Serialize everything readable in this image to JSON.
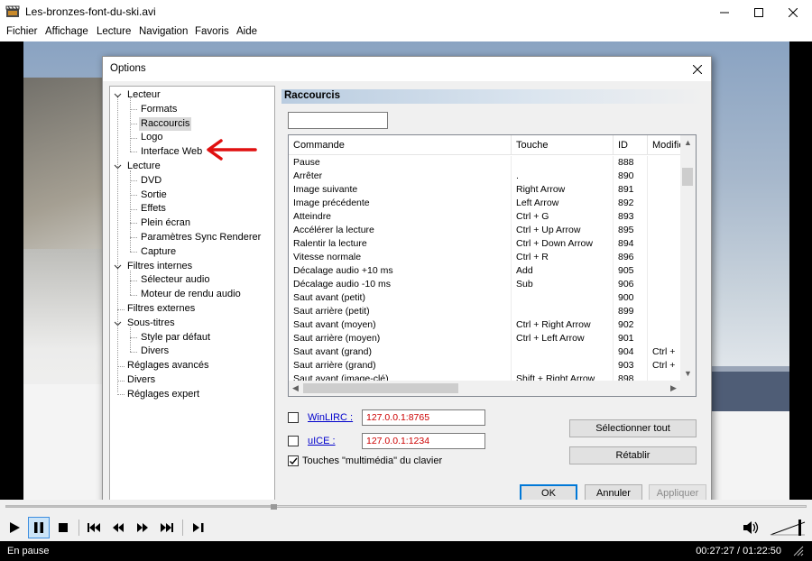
{
  "window": {
    "title": "Les-bronzes-font-du-ski.avi"
  },
  "menu": {
    "items": [
      "Fichier",
      "Affichage",
      "Lecture",
      "Navigation",
      "Favoris",
      "Aide"
    ]
  },
  "dialog": {
    "title": "Options",
    "tree": [
      {
        "label": "Lecteur"
      },
      {
        "label": "Formats"
      },
      {
        "label": "Raccourcis"
      },
      {
        "label": "Logo"
      },
      {
        "label": "Interface Web"
      },
      {
        "label": "Lecture"
      },
      {
        "label": "DVD"
      },
      {
        "label": "Sortie"
      },
      {
        "label": "Effets"
      },
      {
        "label": "Plein écran"
      },
      {
        "label": "Paramètres Sync Renderer"
      },
      {
        "label": "Capture"
      },
      {
        "label": "Filtres internes"
      },
      {
        "label": "Sélecteur audio"
      },
      {
        "label": "Moteur de rendu audio"
      },
      {
        "label": "Filtres externes"
      },
      {
        "label": "Sous-titres"
      },
      {
        "label": "Style par défaut"
      },
      {
        "label": "Divers"
      },
      {
        "label": "Réglages avancés"
      },
      {
        "label": "Divers"
      },
      {
        "label": "Réglages expert"
      }
    ],
    "panel_title": "Raccourcis",
    "filter_value": "",
    "columns": [
      "Commande",
      "Touche",
      "ID",
      "Modifier"
    ],
    "rows": [
      [
        "Pause",
        "",
        "888",
        ""
      ],
      [
        "Arrêter",
        ".",
        "890",
        ""
      ],
      [
        "Image suivante",
        "Right Arrow",
        "891",
        ""
      ],
      [
        "Image précédente",
        "Left Arrow",
        "892",
        ""
      ],
      [
        "Atteindre",
        "Ctrl + G",
        "893",
        ""
      ],
      [
        "Accélérer la lecture",
        "Ctrl + Up Arrow",
        "895",
        ""
      ],
      [
        "Ralentir la lecture",
        "Ctrl + Down Arrow",
        "894",
        ""
      ],
      [
        "Vitesse normale",
        "Ctrl + R",
        "896",
        ""
      ],
      [
        "Décalage audio +10 ms",
        "Add",
        "905",
        ""
      ],
      [
        "Décalage audio -10 ms",
        "Sub",
        "906",
        ""
      ],
      [
        "Saut avant (petit)",
        "",
        "900",
        ""
      ],
      [
        "Saut arrière (petit)",
        "",
        "899",
        ""
      ],
      [
        "Saut avant (moyen)",
        "Ctrl + Right Arrow",
        "902",
        ""
      ],
      [
        "Saut arrière (moyen)",
        "Ctrl + Left Arrow",
        "901",
        ""
      ],
      [
        "Saut avant (grand)",
        "",
        "904",
        "Ctrl +"
      ],
      [
        "Saut arrière (grand)",
        "",
        "903",
        "Ctrl +"
      ],
      [
        "Saut avant (image-clé)",
        "Shift + Right Arrow",
        "898",
        ""
      ]
    ],
    "winlirc": {
      "label": "WinLIRC :",
      "value": "127.0.0.1:8765",
      "checked": false
    },
    "uice": {
      "label": "uICE :",
      "value": "127.0.0.1:1234",
      "checked": false
    },
    "multimedia": {
      "label": "Touches \"multimédia\" du clavier",
      "checked": true
    },
    "select_all_label": "Sélectionner tout",
    "reset_label": "Rétablir",
    "ok_label": "OK",
    "cancel_label": "Annuler",
    "apply_label": "Appliquer"
  },
  "player": {
    "seek_progress": 0.334,
    "volume": 0.85
  },
  "status": {
    "state": "En pause",
    "time": "00:27:27 / 01:22:50"
  }
}
